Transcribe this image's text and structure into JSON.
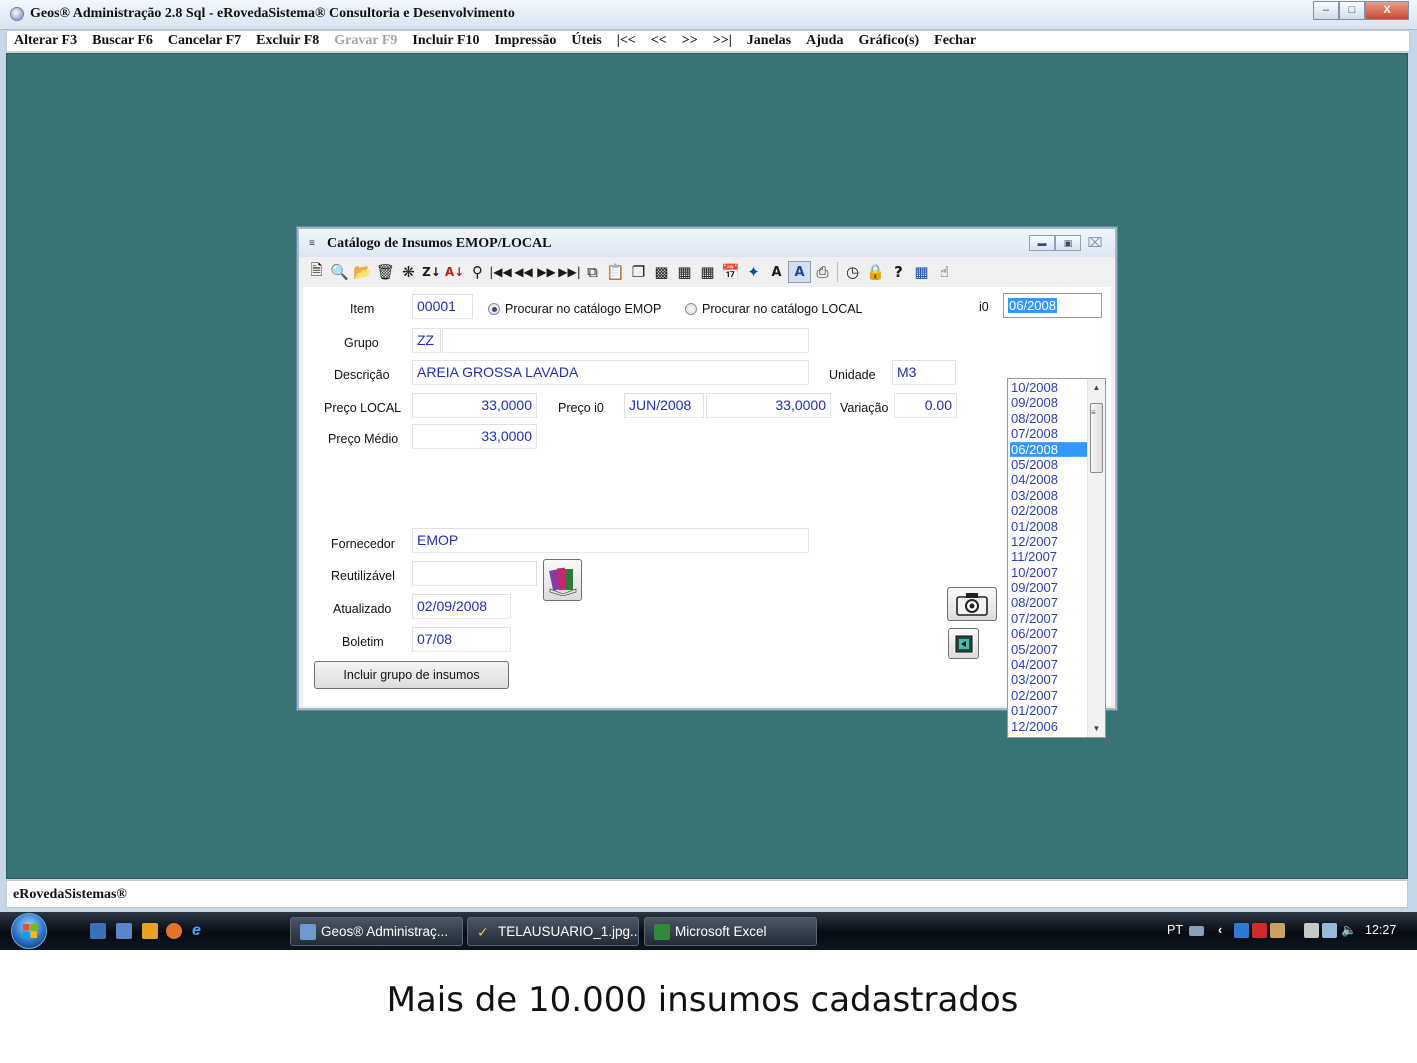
{
  "app": {
    "title": "Geos® Administração 2.8 Sql - eRovedaSistema® Consultoria e Desenvolvimento",
    "window_controls": [
      "minimize-button",
      "maximize-button",
      "close-button"
    ]
  },
  "menu": [
    {
      "label": "Alterar F3",
      "enabled": true
    },
    {
      "label": "Buscar F6",
      "enabled": true
    },
    {
      "label": "Cancelar F7",
      "enabled": true
    },
    {
      "label": "Excluir F8",
      "enabled": true
    },
    {
      "label": "Gravar F9",
      "enabled": false
    },
    {
      "label": "Incluir F10",
      "enabled": true
    },
    {
      "label": "Impressão",
      "enabled": true
    },
    {
      "label": "Úteis",
      "enabled": true
    },
    {
      "label": "|<<",
      "enabled": true
    },
    {
      "label": "<<",
      "enabled": true
    },
    {
      "label": ">>",
      "enabled": true
    },
    {
      "label": ">>|",
      "enabled": true
    },
    {
      "label": "Janelas",
      "enabled": true
    },
    {
      "label": "Ajuda",
      "enabled": true
    },
    {
      "label": "Gráfico(s)",
      "enabled": true
    },
    {
      "label": "Fechar",
      "enabled": true
    }
  ],
  "status_bar": {
    "text": "eRovedaSistemas®"
  },
  "child": {
    "title": "Catálogo de Insumos  EMOP/LOCAL",
    "toolbar_icons": [
      "new-icon",
      "preview-icon",
      "open-icon",
      "delete-icon",
      "clear-icon",
      "sort-za-icon",
      "sort-az-icon",
      "search-icon",
      "first-icon",
      "previous-icon",
      "next-icon",
      "last-icon",
      "copy-icon",
      "paste-icon",
      "frame-icon",
      "grid-icon",
      "table-icon",
      "calculator-icon",
      "calendar-icon",
      "tools-icon",
      "font-icon",
      "filter-icon",
      "print-icon",
      "clock-icon",
      "lock-icon",
      "help-icon",
      "chart-icon",
      "hand-icon"
    ],
    "form": {
      "item_label": "Item",
      "item_value": "00001",
      "radio_emop": "Procurar no catálogo EMOP",
      "radio_local": "Procurar no catálogo LOCAL",
      "radio_selected": "emop",
      "i0_label": "i0",
      "i0_value": "06/2008",
      "grupo_label": "Grupo",
      "grupo_code": "ZZ",
      "grupo_desc": "",
      "descricao_label": "Descrição",
      "descricao_value": "AREIA GROSSA LAVADA",
      "unidade_label": "Unidade",
      "unidade_value": "M3",
      "preco_local_label": "Preço LOCAL",
      "preco_local_value": "33,0000",
      "preco_i0_label": "Preço i0",
      "preco_i0_month": "JUN/2008",
      "preco_i0_value": "33,0000",
      "variacao_label": "Variação",
      "variacao_value": "0.00",
      "preco_medio_label": "Preço Médio",
      "preco_medio_value": "33,0000",
      "fornecedor_label": "Fornecedor",
      "fornecedor_value": "EMOP",
      "reutilizavel_label": "Reutilizável",
      "reutilizavel_value": "",
      "atualizado_label": "Atualizado",
      "atualizado_value": "02/09/2008",
      "boletim_label": "Boletim",
      "boletim_value": "07/08",
      "include_group_button": "Incluir grupo de insumos"
    },
    "period_list": [
      "10/2008",
      "09/2008",
      "08/2008",
      "07/2008",
      "06/2008",
      "05/2008",
      "04/2008",
      "03/2008",
      "02/2008",
      "01/2008",
      "12/2007",
      "11/2007",
      "10/2007",
      "09/2007",
      "08/2007",
      "07/2007",
      "06/2007",
      "05/2007",
      "04/2007",
      "03/2007",
      "02/2007",
      "01/2007",
      "12/2006"
    ],
    "period_selected": "06/2008"
  },
  "taskbar": {
    "tasks": [
      "Geos® Administraç...",
      "TELAUSUARIO_1.jpg...",
      "Microsoft Excel"
    ],
    "language": "PT",
    "clock": "12:27"
  },
  "caption": "Mais de 10.000 insumos cadastrados"
}
